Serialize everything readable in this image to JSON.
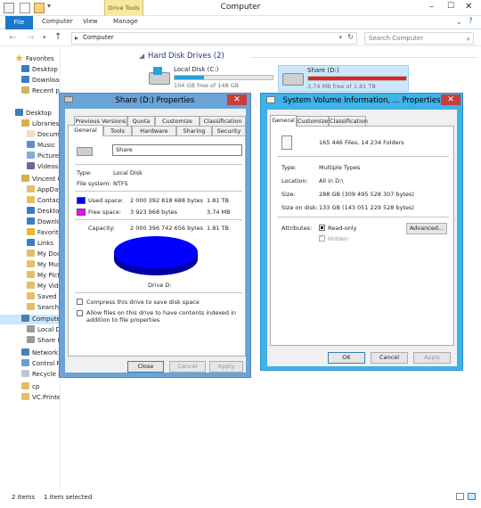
{
  "window": {
    "title": "Computer"
  },
  "ribbon": {
    "context_group": "Drive Tools",
    "tabs": [
      "File",
      "Computer",
      "View",
      "Manage"
    ]
  },
  "address": {
    "path": "Computer",
    "search_placeholder": "Search Computer"
  },
  "sidebar": {
    "favorites_header": "Favorites",
    "favorites": [
      "Desktop",
      "Downloads",
      "Recent places"
    ],
    "desktop": "Desktop",
    "libraries": "Libraries",
    "library_items": [
      "Documen",
      "Music",
      "Pictures",
      "Videos"
    ],
    "user": "Vincent C",
    "user_items": [
      "AppDat",
      "Contact",
      "Desktop",
      "Downlo",
      "Favorite",
      "Links",
      "My Doc",
      "My Mus",
      "My Pict",
      "My Vide",
      "Saved G",
      "Searche"
    ],
    "computer": "Computer",
    "computer_items": [
      "Local D",
      "Share (D"
    ],
    "network": "Network",
    "control_panel": "Control P",
    "recycle_bin": "Recycle B",
    "cp": "cp",
    "vcprinter": "VC.Printer"
  },
  "main": {
    "group_header": "Hard Disk Drives (2)",
    "drives": [
      {
        "name": "Local Disk (C:)",
        "free_text": "104 GB free of 148 GB",
        "used_fraction": 0.3,
        "color": "#26a0da"
      },
      {
        "name": "Share (D:)",
        "free_text": "3,74 MB free of 1,81 TB",
        "used_fraction": 0.998,
        "color": "#da2626"
      }
    ]
  },
  "dialog1": {
    "title": "Share (D:) Properties",
    "tabs_back": [
      "Previous Versions",
      "Quota",
      "Customize",
      "Classification"
    ],
    "tabs_front": [
      "General",
      "Tools",
      "Hardware",
      "Sharing",
      "Security"
    ],
    "name_value": "Share",
    "type_label": "Type:",
    "type_value": "Local Disk",
    "fs_label": "File system:",
    "fs_value": "NTFS",
    "used_label": "Used space:",
    "used_bytes": "2 000 392 818 688 bytes",
    "used_size": "1.81 TB",
    "free_label": "Free space:",
    "free_bytes": "3 923 968 bytes",
    "free_size": "3.74 MB",
    "cap_label": "Capacity:",
    "cap_bytes": "2 000 396 742 656 bytes",
    "cap_size": "1.81 TB",
    "drive_label": "Drive D:",
    "compress_label": "Compress this drive to save disk space",
    "index_label": "Allow files on this drive to have contents indexed in addition to file properties",
    "buttons": {
      "close": "Close",
      "cancel": "Cancel",
      "apply": "Apply"
    },
    "used_color": "#0000ff",
    "free_color": "#ff00ff"
  },
  "dialog2": {
    "title": "System Volume Information, ... Properties",
    "tabs": [
      "General",
      "Customize",
      "Classification"
    ],
    "summary": "165 446 Files, 14 234 Folders",
    "type_label": "Type:",
    "type_value": "Multiple Types",
    "location_label": "Location:",
    "location_value": "All in D:\\",
    "size_label": "Size:",
    "size_value": "288 GB (309 495 528 307 bytes)",
    "disk_label": "Size on disk:",
    "disk_value": "133 GB (143 051 229 528 bytes)",
    "attributes_label": "Attributes:",
    "readonly_label": "Read-only",
    "hidden_label": "Hidden",
    "advanced_label": "Advanced...",
    "buttons": {
      "ok": "OK",
      "cancel": "Cancel",
      "apply": "Apply"
    }
  },
  "status": {
    "items": "2 items",
    "selected": "1 item selected"
  }
}
